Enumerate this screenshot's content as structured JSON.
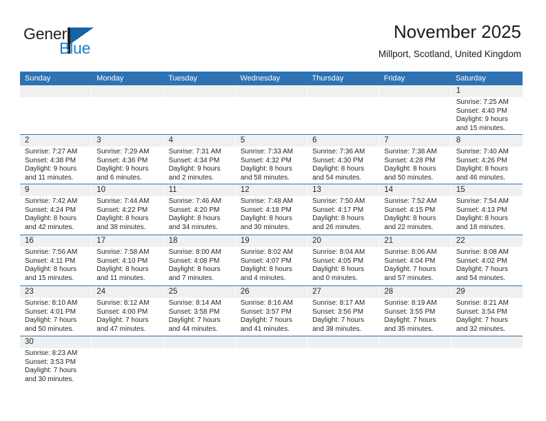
{
  "brand": {
    "logo_text_1": "General",
    "logo_text_2": "Blue",
    "flag_icon": "blue-flag-icon",
    "accent_color": "#1465a8"
  },
  "header": {
    "title": "November 2025",
    "subtitle": "Millport, Scotland, United Kingdom"
  },
  "theme": {
    "header_blue": "#2e72b4",
    "date_band_gray": "#eff0f0",
    "text_color": "#262626"
  },
  "weekdays": [
    "Sunday",
    "Monday",
    "Tuesday",
    "Wednesday",
    "Thursday",
    "Friday",
    "Saturday"
  ],
  "weeks": [
    [
      {
        "day": "",
        "empty": true
      },
      {
        "day": "",
        "empty": true
      },
      {
        "day": "",
        "empty": true
      },
      {
        "day": "",
        "empty": true
      },
      {
        "day": "",
        "empty": true
      },
      {
        "day": "",
        "empty": true
      },
      {
        "day": "1",
        "sunrise": "Sunrise: 7:25 AM",
        "sunset": "Sunset: 4:40 PM",
        "daylight1": "Daylight: 9 hours",
        "daylight2": "and 15 minutes."
      }
    ],
    [
      {
        "day": "2",
        "sunrise": "Sunrise: 7:27 AM",
        "sunset": "Sunset: 4:38 PM",
        "daylight1": "Daylight: 9 hours",
        "daylight2": "and 11 minutes."
      },
      {
        "day": "3",
        "sunrise": "Sunrise: 7:29 AM",
        "sunset": "Sunset: 4:36 PM",
        "daylight1": "Daylight: 9 hours",
        "daylight2": "and 6 minutes."
      },
      {
        "day": "4",
        "sunrise": "Sunrise: 7:31 AM",
        "sunset": "Sunset: 4:34 PM",
        "daylight1": "Daylight: 9 hours",
        "daylight2": "and 2 minutes."
      },
      {
        "day": "5",
        "sunrise": "Sunrise: 7:33 AM",
        "sunset": "Sunset: 4:32 PM",
        "daylight1": "Daylight: 8 hours",
        "daylight2": "and 58 minutes."
      },
      {
        "day": "6",
        "sunrise": "Sunrise: 7:36 AM",
        "sunset": "Sunset: 4:30 PM",
        "daylight1": "Daylight: 8 hours",
        "daylight2": "and 54 minutes."
      },
      {
        "day": "7",
        "sunrise": "Sunrise: 7:38 AM",
        "sunset": "Sunset: 4:28 PM",
        "daylight1": "Daylight: 8 hours",
        "daylight2": "and 50 minutes."
      },
      {
        "day": "8",
        "sunrise": "Sunrise: 7:40 AM",
        "sunset": "Sunset: 4:26 PM",
        "daylight1": "Daylight: 8 hours",
        "daylight2": "and 46 minutes."
      }
    ],
    [
      {
        "day": "9",
        "sunrise": "Sunrise: 7:42 AM",
        "sunset": "Sunset: 4:24 PM",
        "daylight1": "Daylight: 8 hours",
        "daylight2": "and 42 minutes."
      },
      {
        "day": "10",
        "sunrise": "Sunrise: 7:44 AM",
        "sunset": "Sunset: 4:22 PM",
        "daylight1": "Daylight: 8 hours",
        "daylight2": "and 38 minutes."
      },
      {
        "day": "11",
        "sunrise": "Sunrise: 7:46 AM",
        "sunset": "Sunset: 4:20 PM",
        "daylight1": "Daylight: 8 hours",
        "daylight2": "and 34 minutes."
      },
      {
        "day": "12",
        "sunrise": "Sunrise: 7:48 AM",
        "sunset": "Sunset: 4:18 PM",
        "daylight1": "Daylight: 8 hours",
        "daylight2": "and 30 minutes."
      },
      {
        "day": "13",
        "sunrise": "Sunrise: 7:50 AM",
        "sunset": "Sunset: 4:17 PM",
        "daylight1": "Daylight: 8 hours",
        "daylight2": "and 26 minutes."
      },
      {
        "day": "14",
        "sunrise": "Sunrise: 7:52 AM",
        "sunset": "Sunset: 4:15 PM",
        "daylight1": "Daylight: 8 hours",
        "daylight2": "and 22 minutes."
      },
      {
        "day": "15",
        "sunrise": "Sunrise: 7:54 AM",
        "sunset": "Sunset: 4:13 PM",
        "daylight1": "Daylight: 8 hours",
        "daylight2": "and 18 minutes."
      }
    ],
    [
      {
        "day": "16",
        "sunrise": "Sunrise: 7:56 AM",
        "sunset": "Sunset: 4:11 PM",
        "daylight1": "Daylight: 8 hours",
        "daylight2": "and 15 minutes."
      },
      {
        "day": "17",
        "sunrise": "Sunrise: 7:58 AM",
        "sunset": "Sunset: 4:10 PM",
        "daylight1": "Daylight: 8 hours",
        "daylight2": "and 11 minutes."
      },
      {
        "day": "18",
        "sunrise": "Sunrise: 8:00 AM",
        "sunset": "Sunset: 4:08 PM",
        "daylight1": "Daylight: 8 hours",
        "daylight2": "and 7 minutes."
      },
      {
        "day": "19",
        "sunrise": "Sunrise: 8:02 AM",
        "sunset": "Sunset: 4:07 PM",
        "daylight1": "Daylight: 8 hours",
        "daylight2": "and 4 minutes."
      },
      {
        "day": "20",
        "sunrise": "Sunrise: 8:04 AM",
        "sunset": "Sunset: 4:05 PM",
        "daylight1": "Daylight: 8 hours",
        "daylight2": "and 0 minutes."
      },
      {
        "day": "21",
        "sunrise": "Sunrise: 8:06 AM",
        "sunset": "Sunset: 4:04 PM",
        "daylight1": "Daylight: 7 hours",
        "daylight2": "and 57 minutes."
      },
      {
        "day": "22",
        "sunrise": "Sunrise: 8:08 AM",
        "sunset": "Sunset: 4:02 PM",
        "daylight1": "Daylight: 7 hours",
        "daylight2": "and 54 minutes."
      }
    ],
    [
      {
        "day": "23",
        "sunrise": "Sunrise: 8:10 AM",
        "sunset": "Sunset: 4:01 PM",
        "daylight1": "Daylight: 7 hours",
        "daylight2": "and 50 minutes."
      },
      {
        "day": "24",
        "sunrise": "Sunrise: 8:12 AM",
        "sunset": "Sunset: 4:00 PM",
        "daylight1": "Daylight: 7 hours",
        "daylight2": "and 47 minutes."
      },
      {
        "day": "25",
        "sunrise": "Sunrise: 8:14 AM",
        "sunset": "Sunset: 3:58 PM",
        "daylight1": "Daylight: 7 hours",
        "daylight2": "and 44 minutes."
      },
      {
        "day": "26",
        "sunrise": "Sunrise: 8:16 AM",
        "sunset": "Sunset: 3:57 PM",
        "daylight1": "Daylight: 7 hours",
        "daylight2": "and 41 minutes."
      },
      {
        "day": "27",
        "sunrise": "Sunrise: 8:17 AM",
        "sunset": "Sunset: 3:56 PM",
        "daylight1": "Daylight: 7 hours",
        "daylight2": "and 38 minutes."
      },
      {
        "day": "28",
        "sunrise": "Sunrise: 8:19 AM",
        "sunset": "Sunset: 3:55 PM",
        "daylight1": "Daylight: 7 hours",
        "daylight2": "and 35 minutes."
      },
      {
        "day": "29",
        "sunrise": "Sunrise: 8:21 AM",
        "sunset": "Sunset: 3:54 PM",
        "daylight1": "Daylight: 7 hours",
        "daylight2": "and 32 minutes."
      }
    ],
    [
      {
        "day": "30",
        "sunrise": "Sunrise: 8:23 AM",
        "sunset": "Sunset: 3:53 PM",
        "daylight1": "Daylight: 7 hours",
        "daylight2": "and 30 minutes."
      },
      {
        "day": "",
        "empty": true
      },
      {
        "day": "",
        "empty": true
      },
      {
        "day": "",
        "empty": true
      },
      {
        "day": "",
        "empty": true
      },
      {
        "day": "",
        "empty": true
      },
      {
        "day": "",
        "empty": true
      }
    ]
  ]
}
